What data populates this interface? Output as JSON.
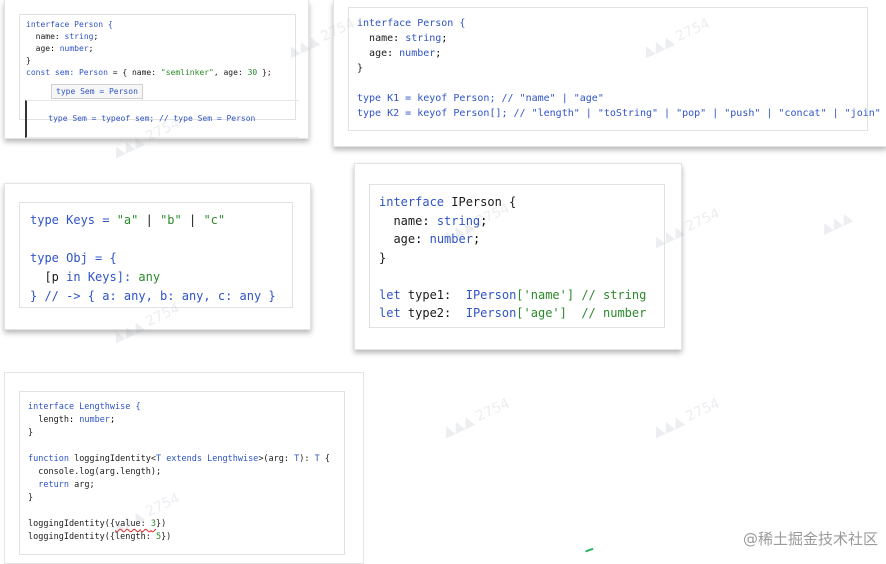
{
  "card1": {
    "l1": "interface Person {",
    "l2_k": "name",
    "l2_t": "string",
    "l3_k": "age",
    "l3_t": "number",
    "l4": "}",
    "l5a": "const sem: ",
    "l5b": "Person",
    "l5c": " = { name: ",
    "l5d": "\"semlinker\"",
    "l5e": ", age: ",
    "l5f": "30",
    "l5g": " };",
    "tooltip": "type Sem = Person",
    "l7a": "type Sem = typeof sem; // type Sem = Person"
  },
  "card2": {
    "l1a": "interface Person {",
    "l2_k": "name",
    "l2_t": "string",
    "l3_k": "age",
    "l3_t": "number",
    "l4": "}",
    "l6": "type K1 = keyof Person; // \"name\" | \"age\"",
    "l7": "type K2 = keyof Person[]; // \"length\" | \"toString\" | \"pop\" | \"push\" | \"concat\" | \"join\""
  },
  "card3": {
    "l1a": "type",
    "l1b": " Keys = ",
    "l1c": "\"a\"",
    "l1d": " | ",
    "l1e": "\"b\"",
    "l1f": " | ",
    "l1g": "\"c\"",
    "l3a": "type",
    "l3b": " Obj = {",
    "l4a": "[p ",
    "l4b": "in",
    "l4c": " Keys]: ",
    "l4d": "any",
    "l5": "} // -> { a: any, b: any, c: any }"
  },
  "card4": {
    "l1a": "interface",
    "l1b": " IPerson {",
    "l2_k": "name",
    "l2_t": "string",
    "l3_k": "age",
    "l3_t": "number",
    "l4": "}",
    "l6a": "let",
    "l6b": " type1:  ",
    "l6c": "IPerson",
    "l6d": "['name']",
    "l6e": " // string",
    "l7a": "let",
    "l7b": " type2:  ",
    "l7c": "IPerson",
    "l7d": "['age']",
    "l7e": "  // number"
  },
  "card5": {
    "l1a": "interface",
    "l1b": " Lengthwise {",
    "l2_k": "length",
    "l2_t": "number",
    "l3": "}",
    "l5a": "function",
    "l5b": " loggingIdentity<",
    "l5c": "T extends Lengthwise",
    "l5d": ">(arg: ",
    "l5e": "T",
    "l5f": "): ",
    "l5g": "T",
    "l5h": " {",
    "l6": "console.log(arg.length);",
    "l7a": "return",
    "l7b": " arg;",
    "l8": "}",
    "l10a": "loggingIdentity({",
    "l10b": "value",
    "l10c": ": ",
    "l10d": "3",
    "l10e": "})",
    "l11a": "loggingIdentity({length: ",
    "l11b": "5",
    "l11c": "})"
  },
  "footer": {
    "site": "@稀土掘金技术社区"
  },
  "colors": {
    "keyword": "#2f54c7",
    "string": "#2b8a2b",
    "text": "#1b1b1b"
  }
}
